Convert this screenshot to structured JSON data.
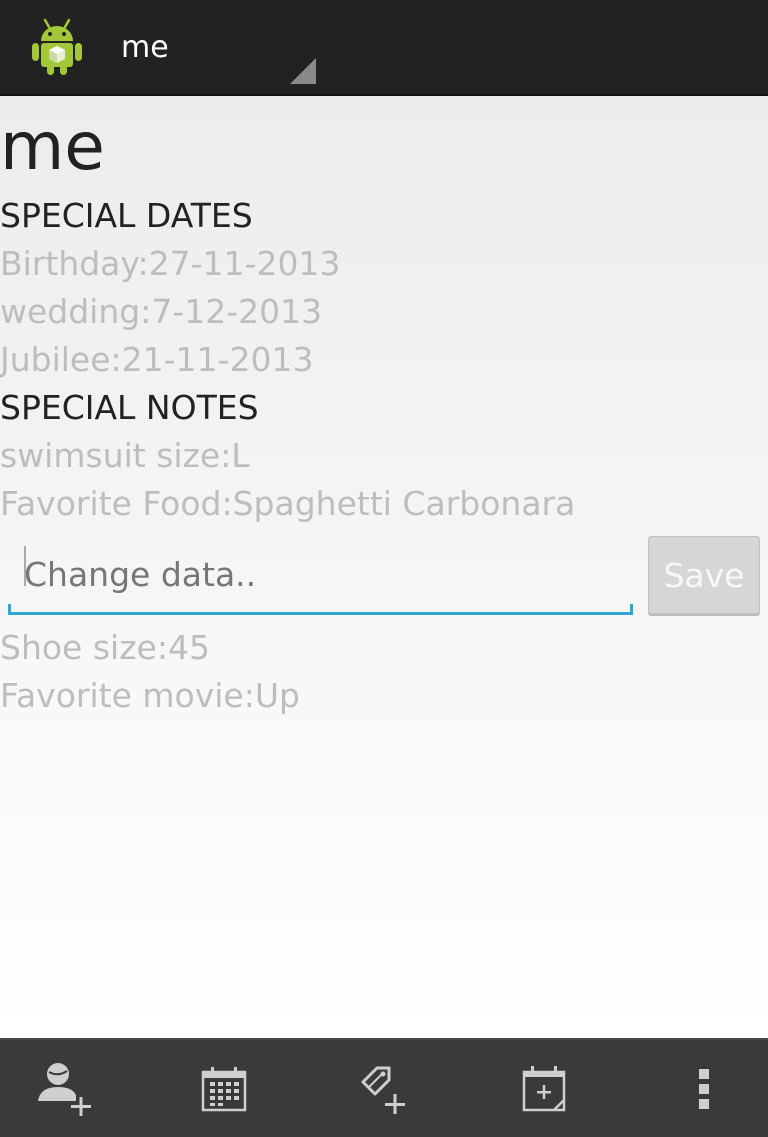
{
  "action_bar": {
    "title": "me",
    "app_icon": "android-robot-icon",
    "spinner_indicator": "dropdown-triangle-icon"
  },
  "contact": {
    "name": "me"
  },
  "special_dates": {
    "header": "SPECIAL DATES",
    "items": [
      "Birthday:27-11-2013",
      "wedding:7-12-2013",
      "Jubilee:21-11-2013"
    ]
  },
  "special_notes": {
    "header": "SPECIAL NOTES",
    "items_before_edit": [
      "swimsuit size:L",
      "Favorite Food:Spaghetti Carbonara"
    ],
    "items_after_edit": [
      "Shoe size:45",
      "Favorite movie:Up"
    ]
  },
  "edit": {
    "placeholder": "Change data..",
    "value": "",
    "save_label": "Save"
  },
  "bottom_bar": {
    "icons": [
      "add-contact-icon",
      "calendar-icon",
      "add-note-icon",
      "add-event-icon",
      "overflow-menu-icon"
    ]
  },
  "colors": {
    "action_bar_bg": "#222222",
    "bottom_bar_bg": "#3a3a3a",
    "accent": "#33a6cf",
    "muted_text": "#bdbdbd",
    "primary_text": "#222222"
  }
}
